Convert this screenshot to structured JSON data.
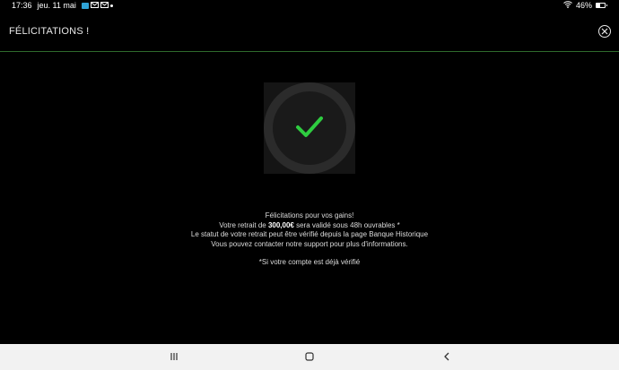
{
  "status_bar": {
    "time": "17:36",
    "date": "jeu. 11 mai",
    "battery": "46%",
    "battery_level": 0.46,
    "icons": [
      "notification-box-icon",
      "mail-icon",
      "mail-icon",
      "dot-icon",
      "wifi-icon",
      "battery-icon"
    ]
  },
  "header": {
    "title": "FÉLICITATIONS !",
    "close_icon": "close-circle-icon"
  },
  "success": {
    "icon": "checkmark-icon",
    "accent_color": "#2ecc40"
  },
  "message": {
    "line1": "Félicitations pour vos gains!",
    "line2_prefix": "Votre retrait de ",
    "line2_amount": "300,00€",
    "line2_suffix": " sera validé sous 48h ouvrables *",
    "line3": "Le statut de votre retrait peut être vérifié depuis la page Banque Historique",
    "line4": "Vous pouvez contacter notre support pour plus d'informations.",
    "footnote": "*Si votre compte est déjà vérifié"
  },
  "nav_bar": {
    "recents_icon": "recents-icon",
    "home_icon": "home-icon",
    "back_icon": "back-icon"
  },
  "colors": {
    "background": "#000000",
    "header_border": "#2f6b2c",
    "nav_bar": "#f2f2f2"
  }
}
